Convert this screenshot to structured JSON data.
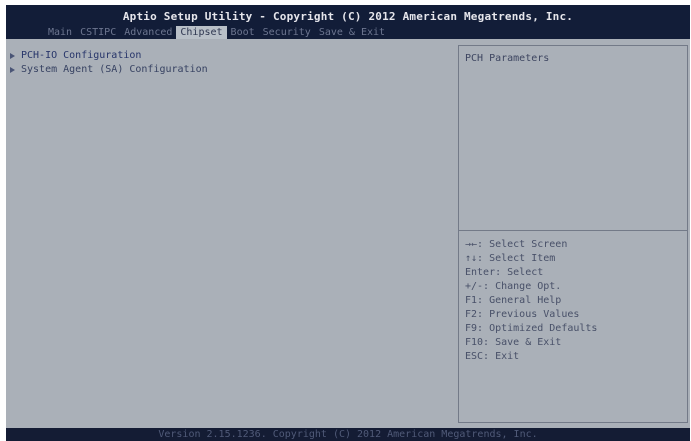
{
  "header": {
    "title": "Aptio Setup Utility - Copyright (C) 2012 American Megatrends, Inc."
  },
  "tabs": [
    {
      "label": "Main"
    },
    {
      "label": "CSTIPC"
    },
    {
      "label": "Advanced"
    },
    {
      "label": "Chipset",
      "active": true
    },
    {
      "label": "Boot"
    },
    {
      "label": "Security"
    },
    {
      "label": "Save & Exit"
    }
  ],
  "menu": {
    "items": [
      {
        "label": "PCH-IO Configuration",
        "selected": true
      },
      {
        "label": "System Agent (SA) Configuration"
      }
    ]
  },
  "help": {
    "text": "PCH Parameters"
  },
  "keys": [
    {
      "label": "→←: Select Screen"
    },
    {
      "label": "↑↓: Select Item"
    },
    {
      "label": "Enter: Select"
    },
    {
      "label": "+/-: Change Opt."
    },
    {
      "label": "F1: General Help"
    },
    {
      "label": "F2: Previous Values"
    },
    {
      "label": "F9: Optimized Defaults"
    },
    {
      "label": "F10: Save & Exit"
    },
    {
      "label": "ESC: Exit"
    }
  ],
  "footer": {
    "text": "Version 2.15.1236. Copyright (C) 2012 American Megatrends, Inc."
  },
  "colors": {
    "header_bg": "#121d38",
    "screen_bg": "#aab0b8",
    "active_tab_bg": "#b9c0c8",
    "text_primary": "#374262",
    "footer_bg": "#141c34"
  }
}
